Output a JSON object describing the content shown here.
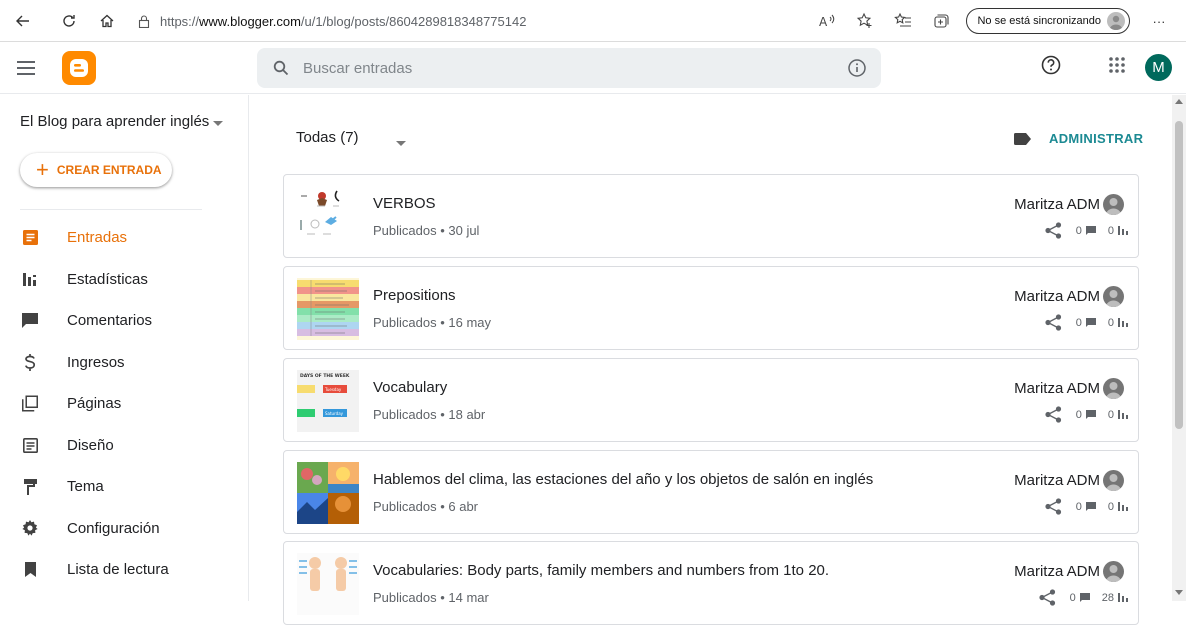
{
  "browser": {
    "url_prefix": "https://",
    "url_host": "www.blogger.com",
    "url_path": "/u/1/blog/posts/8604289818348775142",
    "sync_label": "No se está sincronizando",
    "more_label": "···"
  },
  "header": {
    "search_placeholder": "Buscar entradas",
    "avatar_letter": "M"
  },
  "sidebar": {
    "blog_name": "El Blog para aprender inglés",
    "create_label": "CREAR ENTRADA",
    "create_plus": "+",
    "items": [
      {
        "label": "Entradas",
        "icon": "posts-icon",
        "active": true
      },
      {
        "label": "Estadísticas",
        "icon": "stats-icon",
        "active": false
      },
      {
        "label": "Comentarios",
        "icon": "comments-icon",
        "active": false
      },
      {
        "label": "Ingresos",
        "icon": "dollar-icon",
        "active": false
      },
      {
        "label": "Páginas",
        "icon": "pages-icon",
        "active": false
      },
      {
        "label": "Diseño",
        "icon": "layout-icon",
        "active": false
      },
      {
        "label": "Tema",
        "icon": "theme-icon",
        "active": false
      },
      {
        "label": "Configuración",
        "icon": "settings-icon",
        "active": false
      },
      {
        "label": "Lista de lectura",
        "icon": "bookmark-icon",
        "active": false
      }
    ]
  },
  "main": {
    "filter_label": "Todas (7)",
    "manage_label": "ADMINISTRAR",
    "posts": [
      {
        "title": "VERBOS",
        "meta": "Publicados • 30 jul",
        "author": "Maritza ADM",
        "comments": "0",
        "views": "0"
      },
      {
        "title": "Prepositions",
        "meta": "Publicados • 16 may",
        "author": "Maritza ADM",
        "comments": "0",
        "views": "0"
      },
      {
        "title": "Vocabulary",
        "meta": "Publicados • 18 abr",
        "author": "Maritza ADM",
        "comments": "0",
        "views": "0"
      },
      {
        "title": "Hablemos del clima, las estaciones del año y los objetos de salón en inglés",
        "meta": "Publicados • 6 abr",
        "author": "Maritza ADM",
        "comments": "0",
        "views": "0"
      },
      {
        "title": "Vocabularies: Body parts, family members and numbers from 1to 20.",
        "meta": "Publicados • 14 mar",
        "author": "Maritza ADM",
        "comments": "0",
        "views": "28"
      }
    ],
    "thumb_text": {
      "vocab_header": "DAYS OF THE WEEK",
      "vocab_day1": "Tuesday",
      "vocab_day2": "Saturday"
    }
  },
  "colors": {
    "accent": "#e8710a",
    "logo": "#ff8a00",
    "manage": "#1c8a93",
    "avatar": "#00695c"
  }
}
